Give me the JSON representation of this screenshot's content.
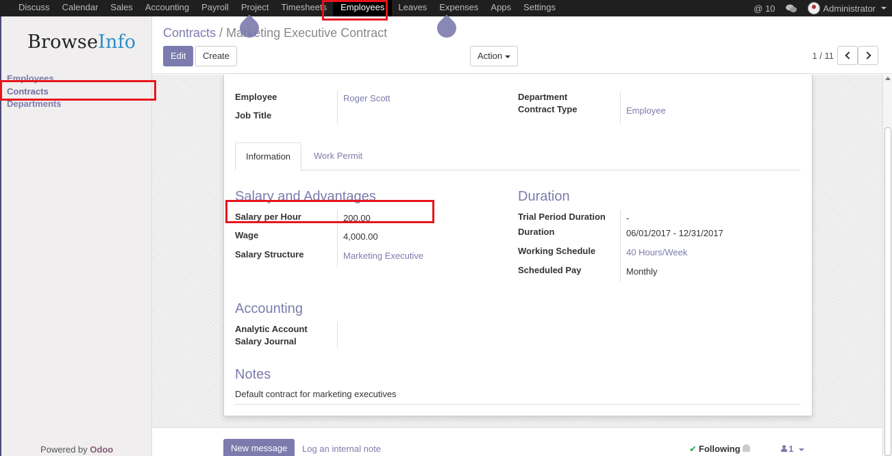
{
  "topbar": {
    "menu": [
      "Discuss",
      "Calendar",
      "Sales",
      "Accounting",
      "Payroll",
      "Project",
      "Timesheets",
      "Employees",
      "Leaves",
      "Expenses",
      "Apps",
      "Settings"
    ],
    "active_menu": "Employees",
    "mentions_count": "@ 10",
    "user_name": "Administrator"
  },
  "sidebar": {
    "logo_text_1": "Browse",
    "logo_text_2": "Info",
    "items": [
      "Employees",
      "Contracts",
      "Departments"
    ],
    "active_item": "Contracts",
    "powered_by": "Powered by",
    "powered_brand": "Odoo"
  },
  "control_panel": {
    "breadcrumb_parent": "Contracts",
    "breadcrumb_sep": "/",
    "breadcrumb_current": "Marketing Executive Contract",
    "edit_label": "Edit",
    "create_label": "Create",
    "action_label": "Action",
    "pager": "1 / 11"
  },
  "form": {
    "employee_label": "Employee",
    "employee_value": "Roger Scott",
    "job_title_label": "Job Title",
    "department_label": "Department",
    "contract_type_label": "Contract Type",
    "contract_type_value": "Employee",
    "tabs": [
      "Information",
      "Work Permit"
    ],
    "salary_section": "Salary and Advantages",
    "salary_per_hour_label": "Salary per Hour",
    "salary_per_hour_value": "200.00",
    "wage_label": "Wage",
    "wage_value": "4,000.00",
    "salary_structure_label": "Salary Structure",
    "salary_structure_value": "Marketing Executive",
    "duration_section": "Duration",
    "trial_period_label": "Trial Period Duration",
    "trial_period_value": "-",
    "duration_label": "Duration",
    "duration_value": "06/01/2017 - 12/31/2017",
    "working_schedule_label": "Working Schedule",
    "working_schedule_value": "40 Hours/Week",
    "scheduled_pay_label": "Scheduled Pay",
    "scheduled_pay_value": "Monthly",
    "accounting_section": "Accounting",
    "analytic_account_label": "Analytic Account",
    "salary_journal_label": "Salary Journal",
    "notes_section": "Notes",
    "notes_value": "Default contract for marketing executives"
  },
  "chatter": {
    "new_message_label": "New message",
    "log_note_label": "Log an internal note",
    "following_label": "Following",
    "followers_count": "1"
  },
  "colors": {
    "accent": "#7c7bad",
    "highlight": "#e8141b",
    "navbar": "#1f1f1f"
  }
}
